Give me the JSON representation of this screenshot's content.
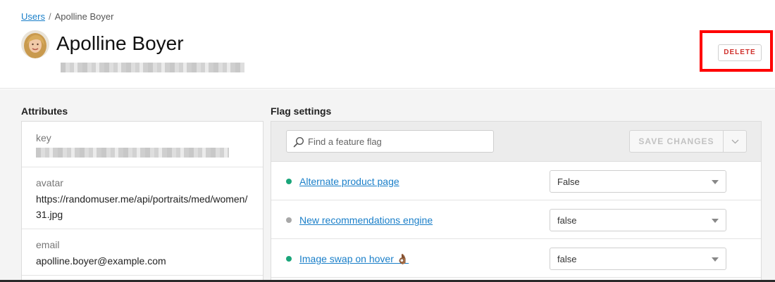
{
  "breadcrumb": {
    "parent": "Users",
    "separator": "/",
    "current": "Apolline Boyer"
  },
  "user": {
    "name": "Apolline Boyer"
  },
  "actions": {
    "delete_label": "DELETE"
  },
  "attributes": {
    "title": "Attributes",
    "items": [
      {
        "label": "key",
        "value": ""
      },
      {
        "label": "avatar",
        "value": "https://randomuser.me/api/portraits/med/women/31.jpg"
      },
      {
        "label": "email",
        "value": "apolline.boyer@example.com"
      }
    ]
  },
  "flags": {
    "title": "Flag settings",
    "search_placeholder": "Find a feature flag",
    "save_label": "SAVE CHANGES",
    "items": [
      {
        "name": "Alternate product page",
        "value": "False",
        "status_color": "#1aa57a"
      },
      {
        "name": "New recommendations engine",
        "value": "false",
        "status_color": "#a8a8a8"
      },
      {
        "name": "Image swap on hover 👌🏾",
        "value": "false",
        "status_color": "#1aa57a"
      }
    ]
  },
  "colors": {
    "accent": "#1a7fc9",
    "danger": "#d0312d",
    "highlight": "#ff0000"
  }
}
